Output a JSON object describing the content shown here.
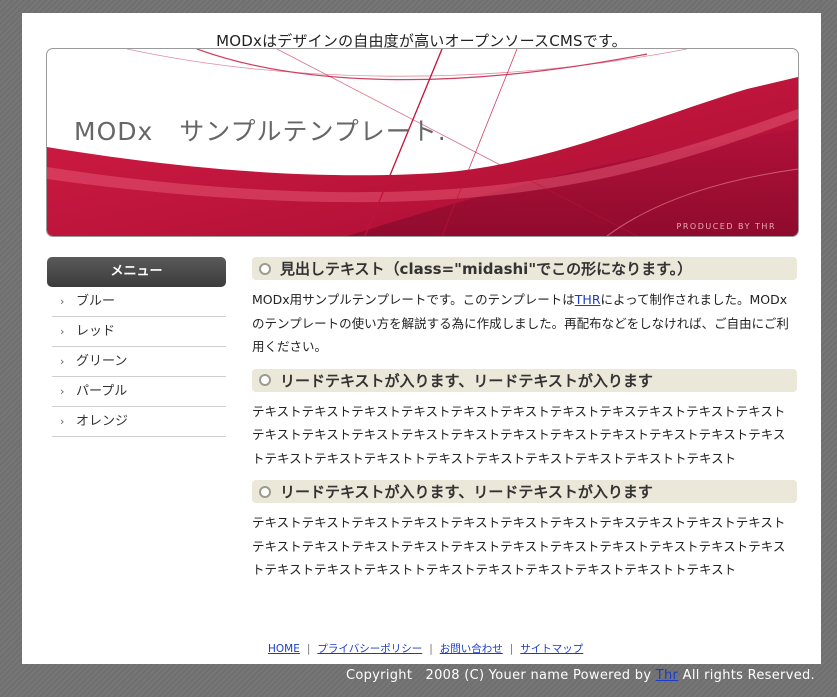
{
  "site": {
    "tagline": "MODxはデザインの自由度が高いオープンソースCMSです。",
    "banner_title": "MODx　サンプルテンプレート.",
    "banner_credit": "PRODUCED BY THR"
  },
  "colors": {
    "accent": "#c0123a",
    "heading_bg": "#ebe7d9",
    "menu_header_bg": "#4a4a4a",
    "link": "#1a3cc8"
  },
  "sidebar": {
    "title": "メニュー",
    "items": [
      {
        "label": "ブルー",
        "icon": "chevron-right-icon"
      },
      {
        "label": "レッド",
        "icon": "chevron-right-icon"
      },
      {
        "label": "グリーン",
        "icon": "chevron-right-icon"
      },
      {
        "label": "パープル",
        "icon": "chevron-right-icon"
      },
      {
        "label": "オレンジ",
        "icon": "chevron-right-icon"
      }
    ]
  },
  "main": {
    "sections": [
      {
        "heading": "見出しテキスト（class=\"midashi\"でこの形になります。）",
        "text_before_link": "MODx用サンプルテンプレートです。このテンプレートは",
        "link": "THR",
        "text_after_link": "によって制作されました。MODxのテンプレートの使い方を解説する為に作成しました。再配布などをしなければ、ご自由にご利用ください。"
      },
      {
        "heading": "リードテキストが入ります、リードテキストが入ります",
        "text": "テキストテキストテキストテキストテキストテキストテキストテキステキストテキストテキストテキストテキストテキストテキストテキストテキストテキストテキストテキストテキストテキストテキストテキストテキストトテキストテキストテキストテキストテキストトテキスト"
      },
      {
        "heading": "リードテキストが入ります、リードテキストが入ります",
        "text": "テキストテキストテキストテキストテキストテキストテキストテキステキストテキストテキストテキストテキストテキストテキストテキストテキストテキストテキストテキストテキストテキストテキストテキストテキストトテキストテキストテキストテキストテキストトテキスト"
      }
    ]
  },
  "footer": {
    "links": [
      "HOME",
      "プライバシーポリシー",
      "お問い合わせ",
      "サイトマップ"
    ],
    "separator": "|",
    "copyright_prefix": "Copyright　2008 (C) Youer name Powered by ",
    "copyright_link": "Thr",
    "copyright_suffix": " All rights Reserved."
  }
}
